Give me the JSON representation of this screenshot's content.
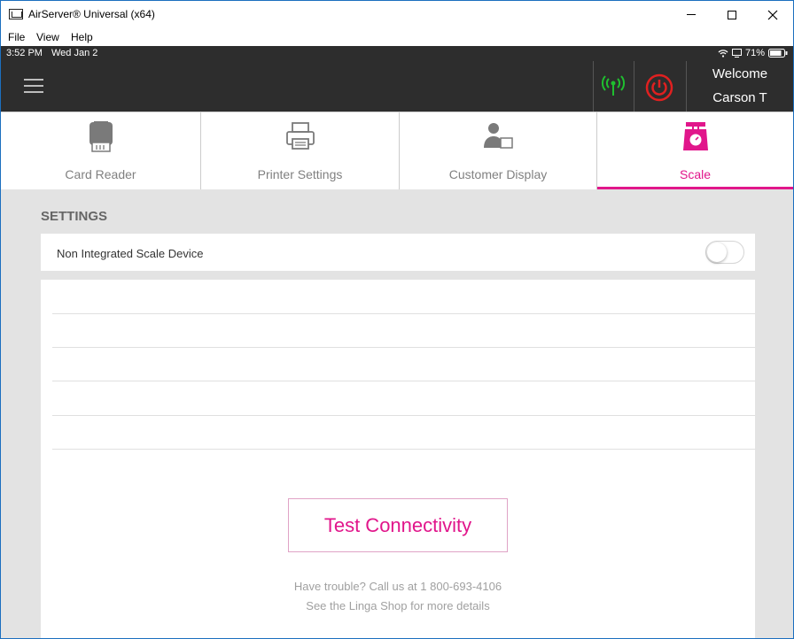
{
  "window": {
    "title": "AirServer® Universal (x64)",
    "controls": {
      "minimize": "minimize",
      "maximize": "maximize",
      "close": "close"
    }
  },
  "menu": [
    "File",
    "View",
    "Help"
  ],
  "statusbar": {
    "time": "3:52 PM",
    "date": "Wed Jan 2",
    "battery": "71%"
  },
  "header": {
    "welcome": "Welcome",
    "user": "Carson T"
  },
  "tabs": [
    {
      "label": "Card Reader",
      "icon": "card-reader-icon"
    },
    {
      "label": "Printer Settings",
      "icon": "printer-icon"
    },
    {
      "label": "Customer Display",
      "icon": "customer-display-icon"
    },
    {
      "label": "Scale",
      "icon": "scale-icon",
      "active": true
    }
  ],
  "settings": {
    "heading": "SETTINGS",
    "non_integrated_label": "Non Integrated Scale Device",
    "toggle_on": false
  },
  "panel": {
    "test_button": "Test Connectivity",
    "help_line1": "Have trouble? Call us at 1 800-693-4106",
    "help_line2": "See the Linga Shop for more details"
  },
  "colors": {
    "accent": "#e1168b",
    "signal": "#1fbf2f",
    "power": "#e02020",
    "dark": "#2d2d2d"
  }
}
